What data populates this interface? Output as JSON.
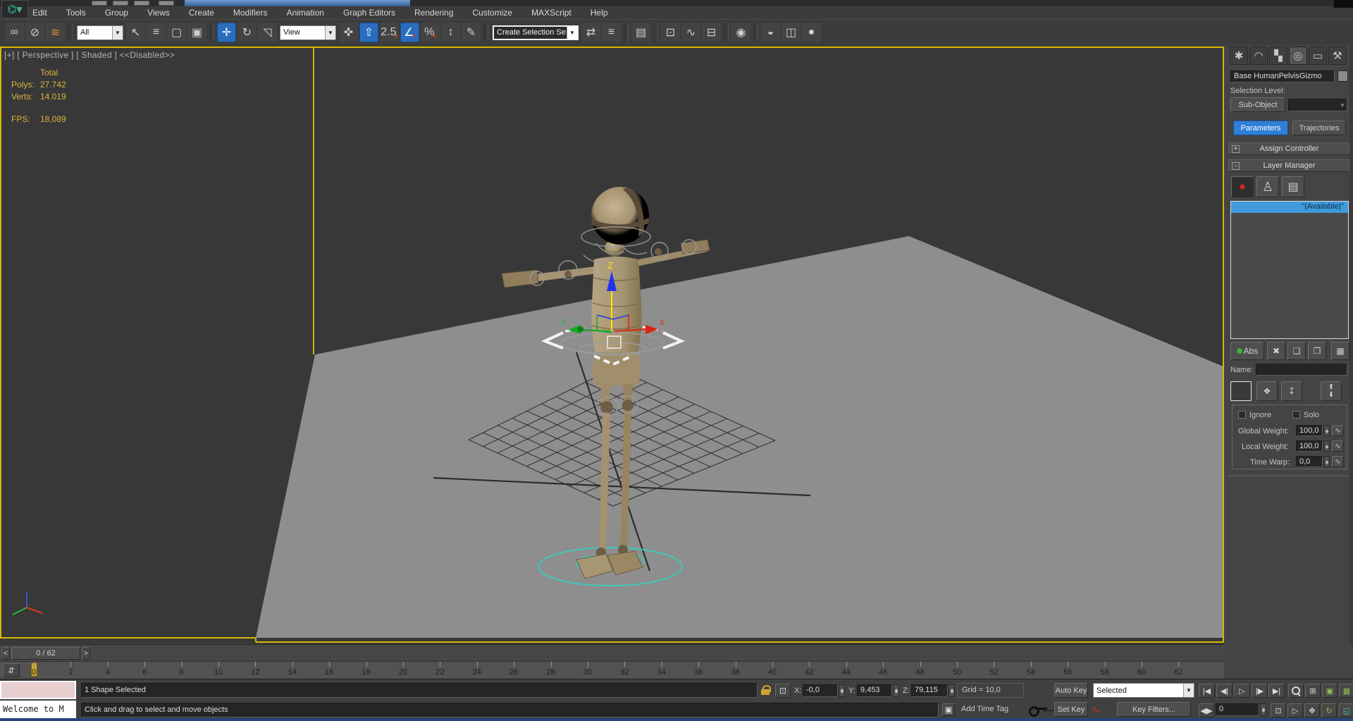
{
  "menu": {
    "items": [
      "Edit",
      "Tools",
      "Group",
      "Views",
      "Create",
      "Modifiers",
      "Animation",
      "Graph Editors",
      "Rendering",
      "Customize",
      "MAXScript",
      "Help"
    ]
  },
  "toolbar": {
    "icons1": [
      {
        "name": "select-and-link-icon",
        "glyph": "∞"
      },
      {
        "name": "unlink-selection-icon",
        "glyph": "⊘"
      },
      {
        "name": "bind-to-space-warp-icon",
        "glyph": "≋"
      }
    ],
    "filter_combo": "All",
    "icons2": [
      {
        "name": "select-object-icon",
        "glyph": "↖"
      },
      {
        "name": "select-by-name-icon",
        "glyph": "≡"
      },
      {
        "name": "rectangular-selection-region-icon",
        "glyph": "▢"
      },
      {
        "name": "window-crossing-icon",
        "glyph": "▣"
      }
    ],
    "icons3": [
      {
        "name": "select-and-move-icon",
        "glyph": "✛",
        "blue": true
      },
      {
        "name": "select-and-rotate-icon",
        "glyph": "↻"
      },
      {
        "name": "select-and-scale-icon",
        "glyph": "◹"
      }
    ],
    "ref_combo": "View",
    "icons4": [
      {
        "name": "select-and-manipulate-icon",
        "glyph": "✜"
      },
      {
        "name": "keyboard-shortcut-override-icon",
        "glyph": "⇧",
        "blue": true
      },
      {
        "name": "snaps-toggle-icon",
        "glyph": "2.5",
        "accent": "n"
      },
      {
        "name": "angle-snap-icon",
        "glyph": "∠",
        "blue": true,
        "accent": "n"
      },
      {
        "name": "percent-snap-icon",
        "glyph": "%",
        "accent": "n"
      },
      {
        "name": "spinner-snap-icon",
        "glyph": "↕"
      },
      {
        "name": "named-selection-sets-icon",
        "glyph": "✎"
      }
    ],
    "selection_set_combo": "Create Selection Se",
    "icons5": [
      {
        "name": "mirror-icon",
        "glyph": "⇄"
      },
      {
        "name": "align-icon",
        "glyph": "≡"
      },
      {
        "name": "layer-manager-icon",
        "glyph": "▤"
      },
      {
        "name": "scene-explorer-icon",
        "glyph": "⊡"
      },
      {
        "name": "curve-editor-icon",
        "glyph": "∿"
      },
      {
        "name": "schematic-view-icon",
        "glyph": "⊟"
      },
      {
        "name": "material-editor-icon",
        "glyph": "◉"
      },
      {
        "name": "render-setup-icon",
        "glyph": "◒"
      },
      {
        "name": "rendered-frame-window-icon",
        "glyph": "◫"
      },
      {
        "name": "render-production-icon",
        "glyph": "●"
      }
    ]
  },
  "viewport": {
    "label": "[+] [ Perspective ] [ Shaded ]  <<Disabled>>",
    "stats": {
      "total_label": "Total",
      "polys_label": "Polys:",
      "polys": "27.742",
      "verts_label": "Verts:",
      "verts": "14.019",
      "fps_label": "FPS:",
      "fps": "18,089"
    },
    "gizmo": {
      "x_label": "x",
      "y_label": "y",
      "z_label": "Z"
    }
  },
  "command_panel": {
    "tabs": [
      {
        "name": "tab-create",
        "glyph": "✱"
      },
      {
        "name": "tab-modify",
        "glyph": "◠"
      },
      {
        "name": "tab-hierarchy",
        "glyph": "▚"
      },
      {
        "name": "tab-motion",
        "glyph": "◎",
        "active": true
      },
      {
        "name": "tab-display",
        "glyph": "▭"
      },
      {
        "name": "tab-utilities",
        "glyph": "⚒"
      }
    ],
    "object_name": "Base HumanPelvisGizmo",
    "selection_level_label": "Selection Level:",
    "sub_object_button": "Sub-Object",
    "parameters_tab": "Parameters",
    "trajectories_tab": "Trajectories",
    "assign_controller_rollout": "Assign Controller",
    "layer_manager_rollout": "Layer Manager",
    "collapse_plus": "+",
    "collapse_minus": "-",
    "layer_list_selected": "\"(Available)\"",
    "abs_button": "Abs",
    "name_label": "Name:",
    "ignore_label": "Ignore",
    "solo_label": "Solo",
    "global_weight_label": "Global Weight:",
    "global_weight": "100,0",
    "local_weight_label": "Local Weight:",
    "local_weight": "100,0",
    "time_warp_label": "Time Warp:",
    "time_warp": "0,0"
  },
  "time_slider": {
    "prev": "<",
    "value": "0 / 62",
    "next": ">"
  },
  "track_bar": {
    "frame_labels": [
      "0",
      "2",
      "4",
      "6",
      "8",
      "10",
      "12",
      "14",
      "16",
      "18",
      "20",
      "22",
      "24",
      "26",
      "28",
      "30",
      "32",
      "34",
      "36",
      "38",
      "40",
      "42",
      "44",
      "46",
      "48",
      "50",
      "52",
      "54",
      "56",
      "58",
      "60",
      "62"
    ]
  },
  "status_bar": {
    "listener_text": "Welcome to M",
    "selection_status": "1 Shape Selected",
    "prompt": "Click and drag to select and move objects",
    "x_label": "X:",
    "x_value": "-0,0",
    "y_label": "Y:",
    "y_value": "9,453",
    "z_label": "Z:",
    "z_value": "79,115",
    "grid_label": "Grid = 10,0",
    "add_time_tag": "Add Time Tag",
    "auto_key": "Auto Key",
    "set_key": "Set Key",
    "key_filter_combo": "Selected",
    "key_filters_button": "Key Filters...",
    "frame_field": "0",
    "playback": [
      {
        "name": "go-to-start-button",
        "glyph": "|◀"
      },
      {
        "name": "previous-frame-button",
        "glyph": "◀|"
      },
      {
        "name": "play-button",
        "glyph": "▷"
      },
      {
        "name": "next-frame-button",
        "glyph": "|▶"
      },
      {
        "name": "go-to-end-button",
        "glyph": "▶|"
      }
    ],
    "nav_row_a": [
      {
        "name": "zoom-icon",
        "glyph": ""
      },
      {
        "name": "zoom-all-icon",
        "glyph": "⊞"
      },
      {
        "name": "zoom-extents-icon",
        "glyph": "▣",
        "cls": "green"
      },
      {
        "name": "zoom-extents-all-icon",
        "glyph": "▦",
        "cls": "green"
      }
    ],
    "nav_row_b": [
      {
        "name": "key-mode-toggle-icon",
        "glyph": "◀▶"
      },
      {
        "name": "time-configuration-icon",
        "glyph": "⊡"
      },
      {
        "name": "zoom-region-icon",
        "glyph": "▷"
      },
      {
        "name": "pan-view-icon",
        "glyph": "✥"
      },
      {
        "name": "orbit-icon",
        "glyph": "↻",
        "cls": "green"
      },
      {
        "name": "maximize-viewport-icon",
        "glyph": "◱",
        "cls": "teal"
      }
    ]
  },
  "colors": {
    "accent_blue": "#2a6dbe",
    "selection_blue": "#3f9bdc",
    "viewport_border": "#d4b800",
    "stats_yellow": "#d9b33c",
    "ground_gray": "#8e8e8e",
    "teal_outline": "#3fc8b8"
  }
}
